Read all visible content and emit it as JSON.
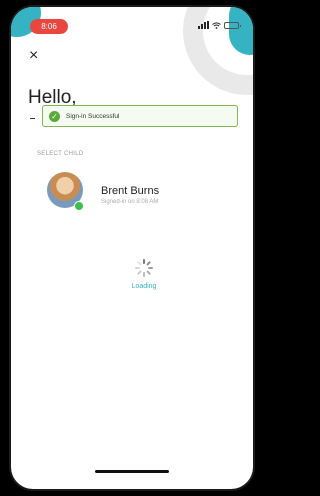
{
  "status_bar": {
    "time": "8:06",
    "icons": [
      "signal-icon",
      "wifi-icon",
      "battery-icon"
    ]
  },
  "header": {
    "close_icon": "×",
    "greeting": "Hello,"
  },
  "toast": {
    "icon": "✓",
    "message": "Sign-in Successful",
    "color": "#7db94c"
  },
  "section": {
    "label": "SELECT CHILD"
  },
  "child": {
    "name": "Brent Burns",
    "status_text": "Signed-in on 8:08 AM",
    "status_color": "#3cbf4a"
  },
  "loading": {
    "text": "Loading"
  },
  "colors": {
    "accent": "#35b3c2",
    "time_pill": "#e8473f"
  }
}
